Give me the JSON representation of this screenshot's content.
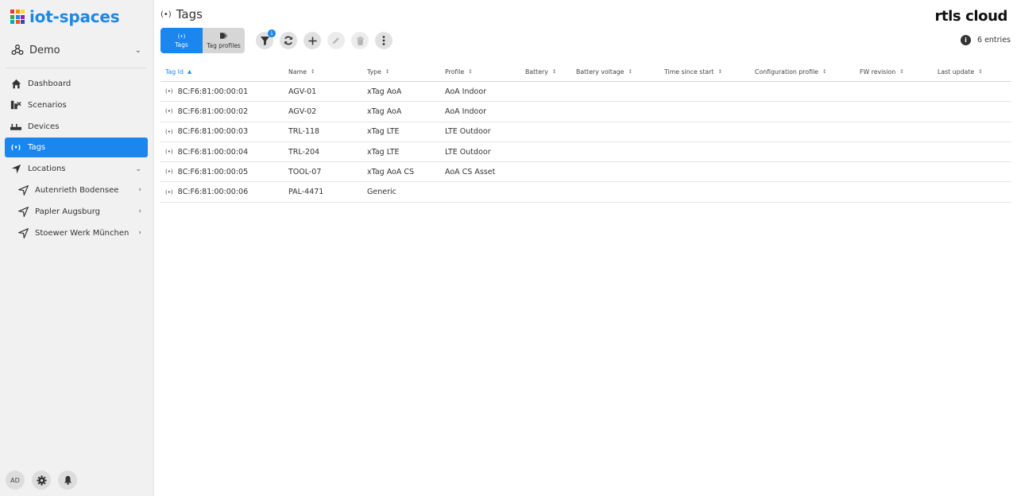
{
  "app": {
    "logo_text": "iot-spaces",
    "logo_colors": [
      "#e53935",
      "#fb8c00",
      "#fdd835",
      "#43a047",
      "#1e88e5",
      "#8e24aa",
      "#00acc1",
      "#f4511e",
      "#3949ab"
    ],
    "accent_color": "#1a86ee"
  },
  "space_selector": {
    "label": "Demo",
    "icon": "org-chart-icon"
  },
  "sidebar": {
    "items": [
      {
        "label": "Dashboard",
        "icon": "home-icon"
      },
      {
        "label": "Scenarios",
        "icon": "scenarios-icon"
      },
      {
        "label": "Devices",
        "icon": "devices-icon"
      },
      {
        "label": "Tags",
        "icon": "broadcast-icon",
        "active": true
      },
      {
        "label": "Locations",
        "icon": "location-arrow-icon",
        "expandable": true
      }
    ],
    "locations": [
      {
        "label": "Autenrieth Bodensee",
        "icon": "location-arrow-icon"
      },
      {
        "label": "Papler Augsburg",
        "icon": "location-arrow-icon"
      },
      {
        "label": "Stoewer Werk München",
        "icon": "location-arrow-icon"
      }
    ],
    "bottom": {
      "avatar_initials": "AD"
    }
  },
  "page": {
    "title": "Tags",
    "brand": "rtls cloud",
    "entries_label": "6 entries"
  },
  "view_tabs": [
    {
      "label": "Tags",
      "icon": "broadcast-icon",
      "active": true
    },
    {
      "label": "Tag profiles",
      "icon": "tags-icon",
      "active": false
    }
  ],
  "toolbar": {
    "filter_badge": "1"
  },
  "table": {
    "columns": [
      "Tag Id",
      "Name",
      "Type",
      "Profile",
      "Battery",
      "Battery voltage",
      "Time since start",
      "Configuration profile",
      "FW revision",
      "Last update"
    ],
    "sorted_column": "Tag Id",
    "rows": [
      [
        "8C:F6:81:00:00:01",
        "AGV-01",
        "xTag AoA",
        "AoA Indoor",
        "",
        "",
        "",
        "",
        "",
        ""
      ],
      [
        "8C:F6:81:00:00:02",
        "AGV-02",
        "xTag AoA",
        "AoA Indoor",
        "",
        "",
        "",
        "",
        "",
        ""
      ],
      [
        "8C:F6:81:00:00:03",
        "TRL-118",
        "xTag LTE",
        "LTE Outdoor",
        "",
        "",
        "",
        "",
        "",
        ""
      ],
      [
        "8C:F6:81:00:00:04",
        "TRL-204",
        "xTag LTE",
        "LTE Outdoor",
        "",
        "",
        "",
        "",
        "",
        ""
      ],
      [
        "8C:F6:81:00:00:05",
        "TOOL-07",
        "xTag AoA CS",
        "AoA CS Asset",
        "",
        "",
        "",
        "",
        "",
        ""
      ],
      [
        "8C:F6:81:00:00:06",
        "PAL-4471",
        "Generic",
        "",
        "",
        "",
        "",
        "",
        "",
        ""
      ]
    ]
  }
}
